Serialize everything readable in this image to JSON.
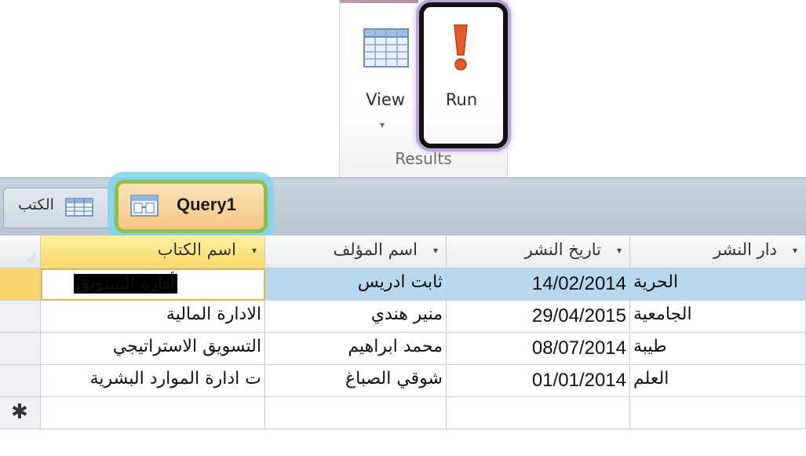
{
  "ribbon": {
    "view_label": "View",
    "view_arrow": "▾",
    "run_label": "Run",
    "group_label": "Results"
  },
  "tabs": {
    "books_label": "الكتب",
    "query_label": "Query1"
  },
  "table": {
    "columns": [
      "اسم الكتاب",
      "اسم المؤلف",
      "تاريخ النشر",
      "دار النشر"
    ],
    "sort_arrow": "▾",
    "rows": [
      {
        "book": "أدارة التسويق",
        "author": "ثابت ادريس",
        "date": "14/02/2014",
        "publisher": "الحرية"
      },
      {
        "book": "الادارة المالية",
        "author": "منير هندي",
        "date": "29/04/2015",
        "publisher": "الجامعية"
      },
      {
        "book": "التسويق الاستراتيجي",
        "author": "محمد ابراهيم",
        "date": "08/07/2014",
        "publisher": "طيبة"
      },
      {
        "book": "ت ادارة الموارد البشرية",
        "author": "شوقي الصباغ",
        "date": "01/01/2014",
        "publisher": "العلم"
      }
    ],
    "new_row_marker": "✱"
  },
  "colors": {
    "run_icon": "#e35a2a",
    "highlight_row": "#b8d7ef",
    "selected_header": "#f8d86a",
    "run_frame": "#111111",
    "tab_frame": "#8fbf4a"
  }
}
